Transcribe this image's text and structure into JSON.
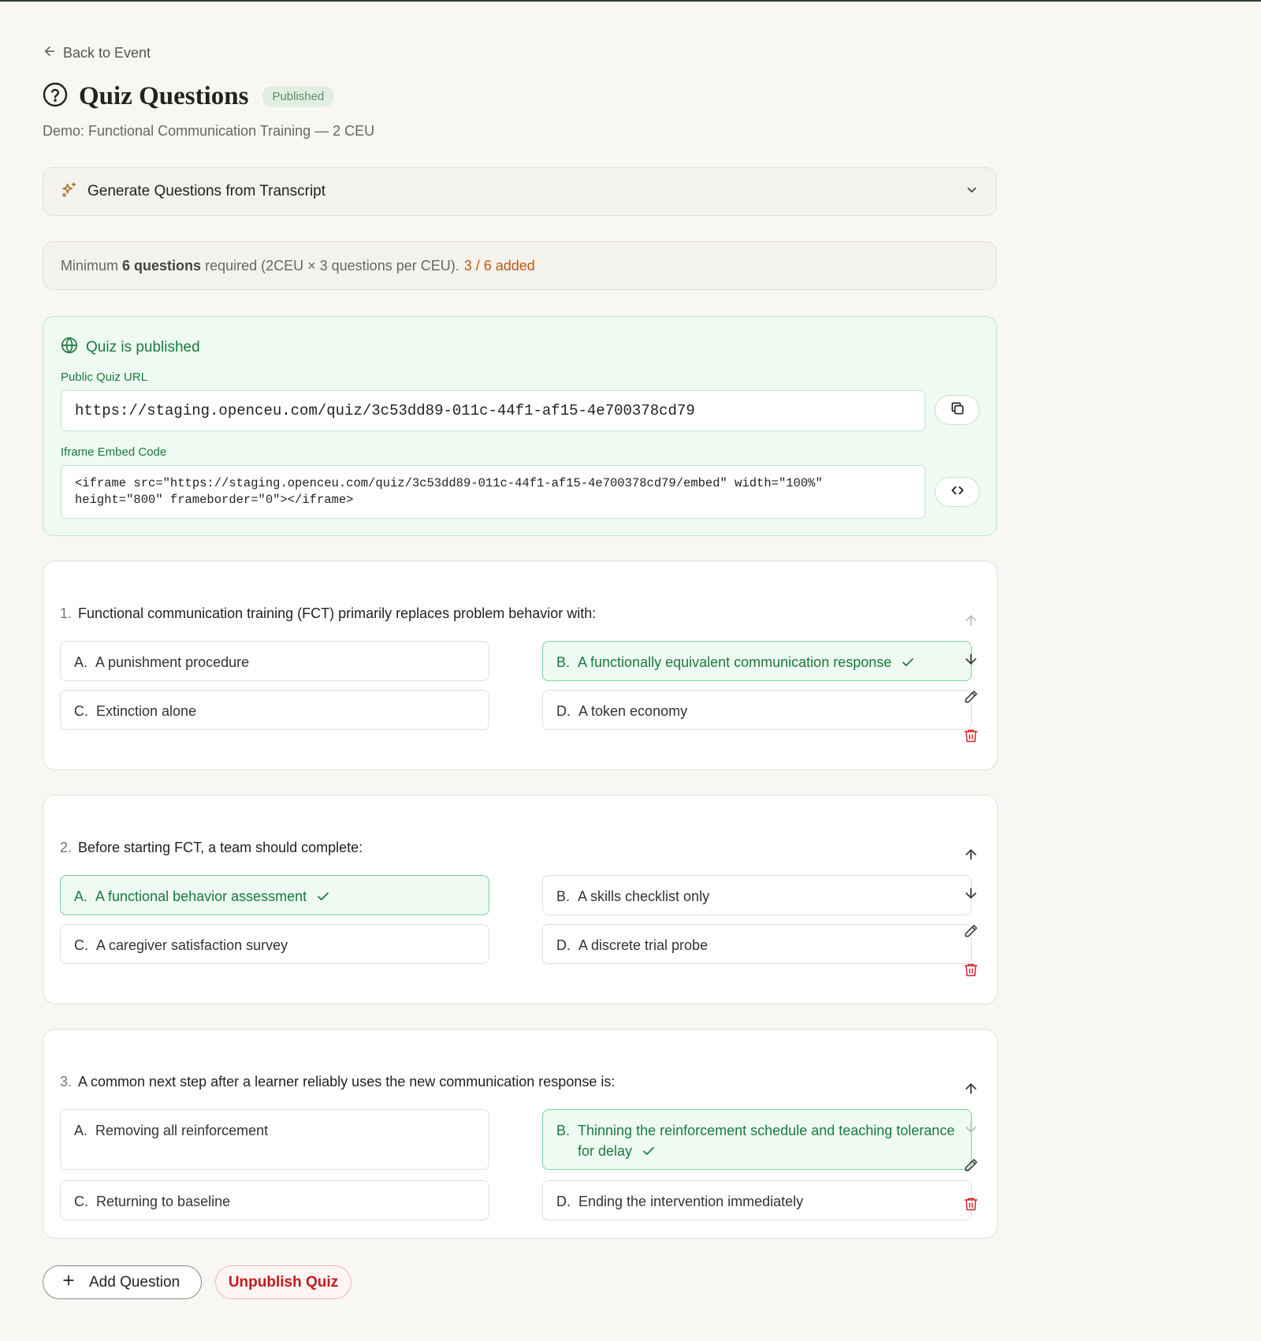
{
  "header": {
    "back_label": "Back to Event",
    "title": "Quiz Questions",
    "badge": "Published",
    "subtitle": "Demo: Functional Communication Training — 2 CEU"
  },
  "generate": {
    "label": "Generate Questions from Transcript"
  },
  "requirement": {
    "prefix": "Minimum",
    "bold": "6 questions",
    "suffix": "required (2CEU × 3 questions per CEU).",
    "count": "3 / 6 added"
  },
  "published": {
    "heading": "Quiz is published",
    "url_label": "Public Quiz URL",
    "url": "https://staging.openceu.com/quiz/3c53dd89-011c-44f1-af15-4e700378cd79",
    "embed_label": "Iframe Embed Code",
    "embed": "<iframe src=\"https://staging.openceu.com/quiz/3c53dd89-011c-44f1-af15-4e700378cd79/embed\" width=\"100%\"\nheight=\"800\" frameborder=\"0\"></iframe>"
  },
  "questions": [
    {
      "num": "1.",
      "text": "Functional communication training (FCT) primarily replaces problem behavior with:",
      "options": [
        {
          "letter": "A.",
          "text": "A punishment procedure"
        },
        {
          "letter": "B.",
          "text": "A functionally equivalent communication response"
        },
        {
          "letter": "C.",
          "text": "Extinction alone"
        },
        {
          "letter": "D.",
          "text": "A token economy"
        }
      ],
      "correct": "B"
    },
    {
      "num": "2.",
      "text": "Before starting FCT, a team should complete:",
      "options": [
        {
          "letter": "A.",
          "text": "A functional behavior assessment"
        },
        {
          "letter": "B.",
          "text": "A skills checklist only"
        },
        {
          "letter": "C.",
          "text": "A caregiver satisfaction survey"
        },
        {
          "letter": "D.",
          "text": "A discrete trial probe"
        }
      ],
      "correct": "A"
    },
    {
      "num": "3.",
      "text": "A common next step after a learner reliably uses the new communication response is:",
      "options": [
        {
          "letter": "A.",
          "text": "Removing all reinforcement"
        },
        {
          "letter": "B.",
          "text": "Thinning the reinforcement schedule and teaching tolerance for delay"
        },
        {
          "letter": "C.",
          "text": "Returning to baseline"
        },
        {
          "letter": "D.",
          "text": "Ending the intervention immediately"
        }
      ],
      "correct": "B"
    }
  ],
  "actions": {
    "add_question": "Add Question",
    "unpublish": "Unpublish Quiz"
  },
  "colors": {
    "accent_green": "#1b7a3e",
    "warning_orange": "#c05a14",
    "danger_red": "#c01b1b",
    "page_bg": "#f9f7f3"
  },
  "icons": {
    "back": "arrow-left-icon",
    "title": "question-circle-icon",
    "generate": "sparkles-icon",
    "expand": "chevron-down-icon",
    "published": "globe-icon",
    "copy": "copy-icon",
    "embed": "code-icon",
    "move_up": "arrow-up-icon",
    "move_down": "arrow-down-icon",
    "edit": "pencil-icon",
    "delete": "trash-icon",
    "add": "plus-icon",
    "correct": "check-icon"
  }
}
